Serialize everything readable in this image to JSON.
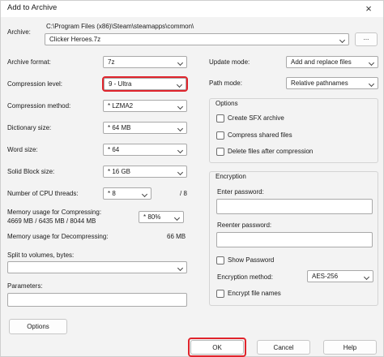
{
  "window": {
    "title": "Add to Archive",
    "close_symbol": "×"
  },
  "archive": {
    "label": "Archive:",
    "path": "C:\\Program Files (x86)\\Steam\\steamapps\\common\\",
    "filename": "Clicker Heroes.7z",
    "browse_label": "..."
  },
  "left": {
    "archive_format": {
      "label": "Archive format:",
      "value": "7z"
    },
    "compression_level": {
      "label": "Compression level:",
      "value": "9 - Ultra"
    },
    "compression_method": {
      "label": "Compression method:",
      "value": "*  LZMA2"
    },
    "dictionary_size": {
      "label": "Dictionary size:",
      "value": "*  64 MB"
    },
    "word_size": {
      "label": "Word size:",
      "value": "*  64"
    },
    "solid_block_size": {
      "label": "Solid Block size:",
      "value": "*  16 GB"
    },
    "cpu_threads": {
      "label": "Number of CPU threads:",
      "value": "*  8",
      "total": "/ 8"
    },
    "memory_compress": {
      "label": "Memory usage for Compressing:",
      "detail": "4669 MB / 6435 MB / 8044 MB",
      "value": "* 80%"
    },
    "memory_decompress": {
      "label": "Memory usage for Decompressing:",
      "value": "66 MB"
    },
    "split": {
      "label": "Split to volumes, bytes:",
      "value": ""
    },
    "parameters": {
      "label": "Parameters:",
      "value": ""
    },
    "options_button": "Options"
  },
  "right": {
    "update_mode": {
      "label": "Update mode:",
      "value": "Add and replace files"
    },
    "path_mode": {
      "label": "Path mode:",
      "value": "Relative pathnames"
    },
    "options_group": {
      "title": "Options",
      "items": [
        "Create SFX archive",
        "Compress shared files",
        "Delete files after compression"
      ]
    },
    "encryption": {
      "title": "Encryption",
      "enter_password_label": "Enter password:",
      "reenter_password_label": "Reenter password:",
      "show_password_label": "Show Password",
      "method_label": "Encryption method:",
      "method_value": "AES-256",
      "encrypt_names_label": "Encrypt file names"
    }
  },
  "footer": {
    "ok": "OK",
    "cancel": "Cancel",
    "help": "Help"
  },
  "colors": {
    "highlight": "#e0242c"
  }
}
